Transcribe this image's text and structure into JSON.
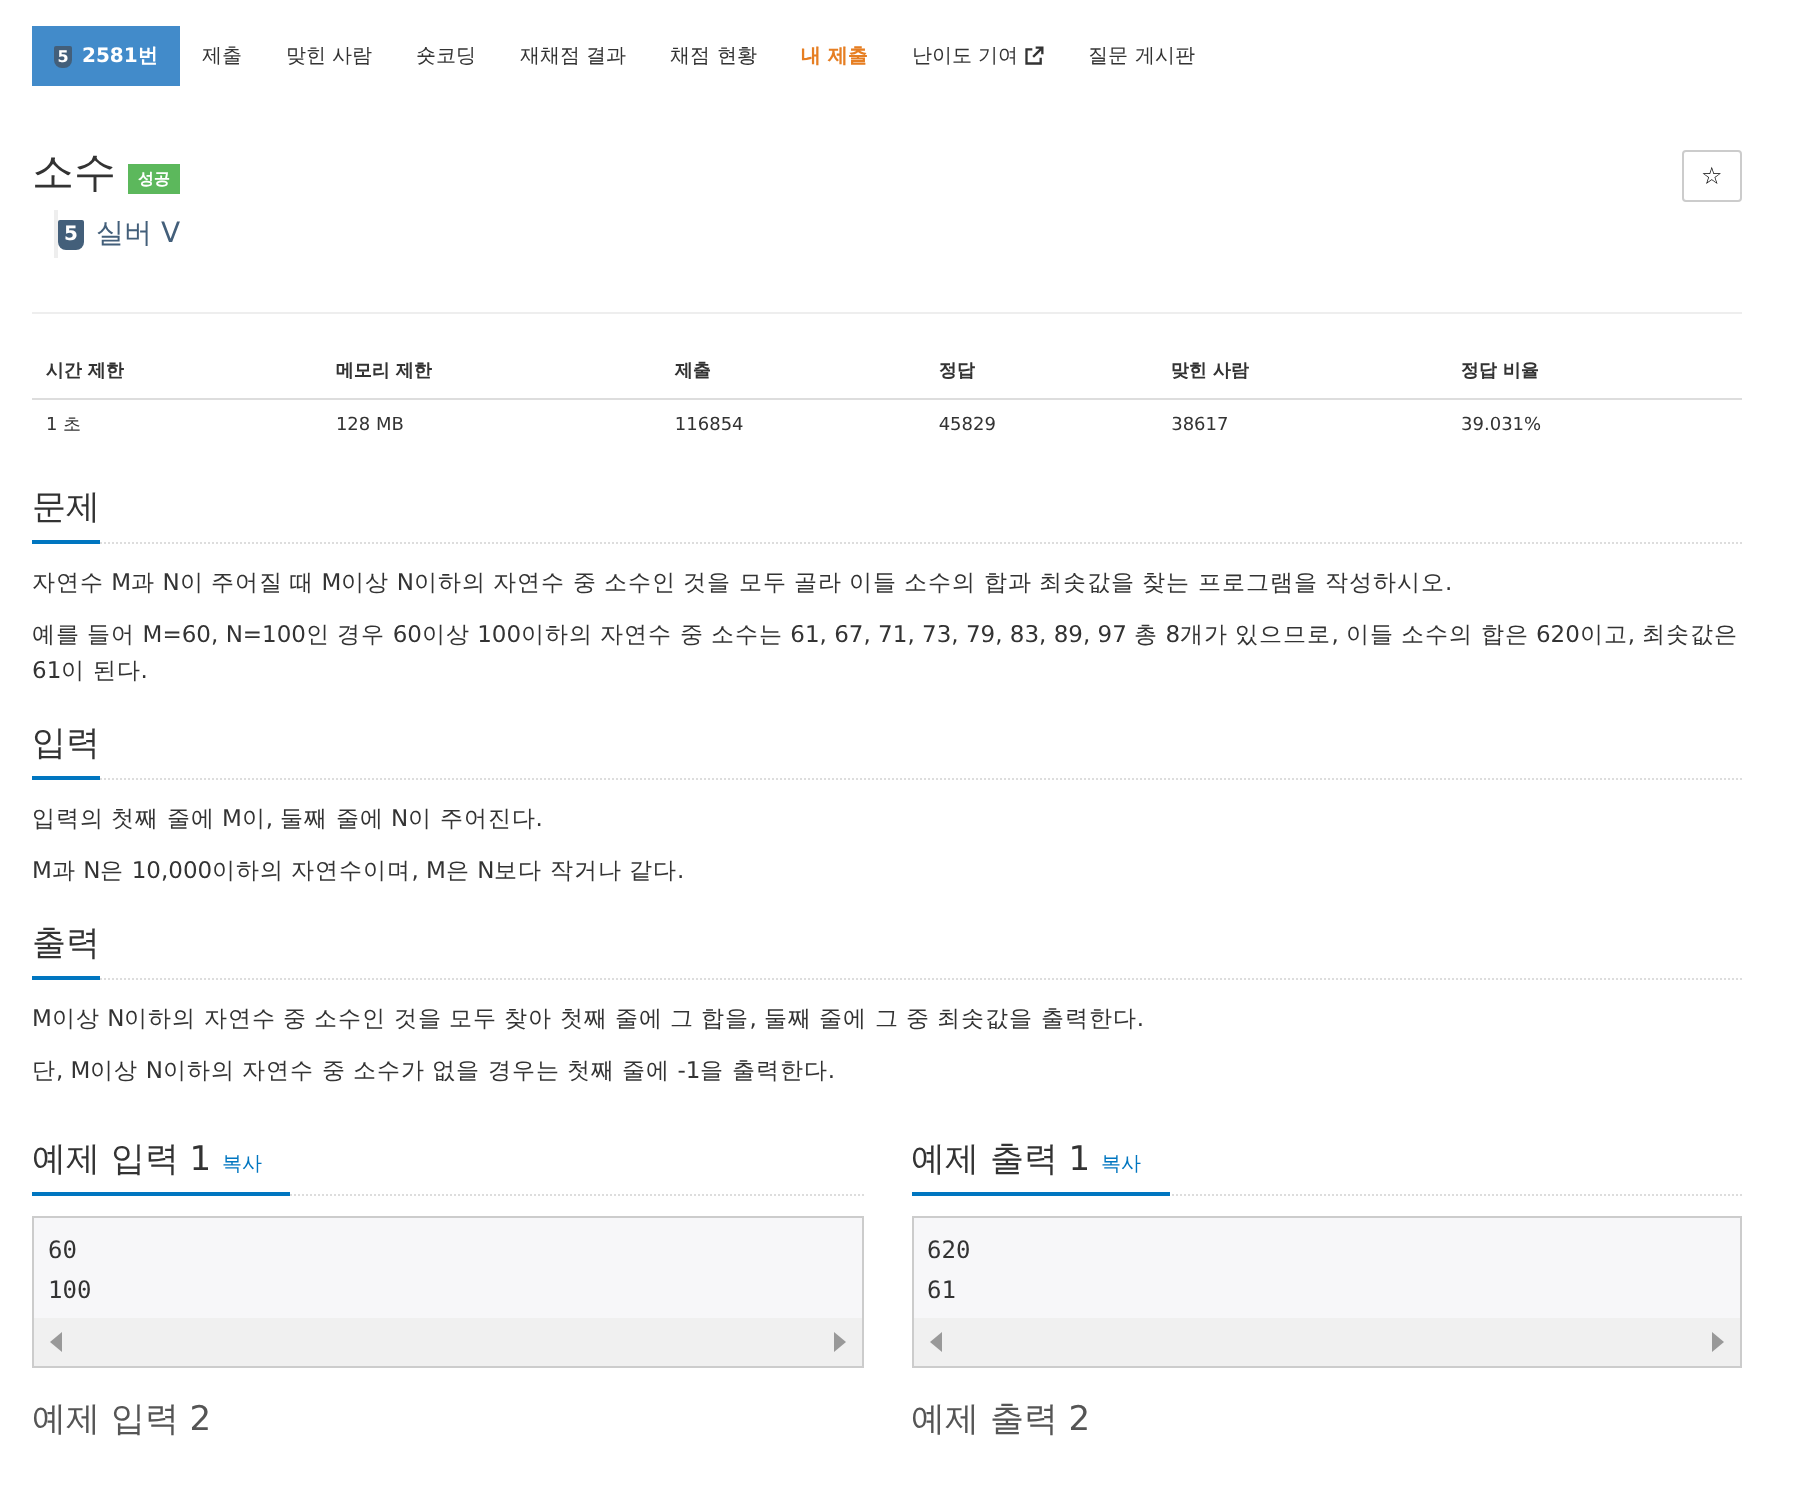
{
  "nav": [
    {
      "label": "2581번",
      "selected": true,
      "highlighted": false,
      "external": false,
      "badge": "5"
    },
    {
      "label": "제출",
      "selected": false,
      "highlighted": false,
      "external": false
    },
    {
      "label": "맞힌 사람",
      "selected": false,
      "highlighted": false,
      "external": false
    },
    {
      "label": "숏코딩",
      "selected": false,
      "highlighted": false,
      "external": false
    },
    {
      "label": "재채점 결과",
      "selected": false,
      "highlighted": false,
      "external": false
    },
    {
      "label": "채점 현황",
      "selected": false,
      "highlighted": false,
      "external": false
    },
    {
      "label": "내 제출",
      "selected": false,
      "highlighted": true,
      "external": false
    },
    {
      "label": "난이도 기여",
      "selected": false,
      "highlighted": false,
      "external": true
    },
    {
      "label": "질문 게시판",
      "selected": false,
      "highlighted": false,
      "external": false
    }
  ],
  "problem": {
    "title": "소수",
    "result_label": "성공",
    "star": "☆",
    "tier_badge": "5",
    "tier": "실버 V"
  },
  "stats": {
    "columns": [
      "시간 제한",
      "메모리 제한",
      "제출",
      "정답",
      "맞힌 사람",
      "정답 비율"
    ],
    "rows": [
      [
        "1 초",
        "128 MB",
        "116854",
        "45829",
        "38617",
        "39.031%"
      ]
    ]
  },
  "sections": [
    {
      "heading": "문제",
      "paragraphs": [
        "자연수 M과 N이 주어질 때 M이상 N이하의 자연수 중 소수인 것을 모두 골라 이들 소수의 합과 최솟값을 찾는 프로그램을 작성하시오.",
        "예를 들어 M=60, N=100인 경우 60이상 100이하의 자연수 중 소수는 61, 67, 71, 73, 79, 83, 89, 97 총 8개가 있으므로, 이들 소수의 합은 620이고, 최솟값은 61이 된다."
      ]
    },
    {
      "heading": "입력",
      "paragraphs": [
        "입력의 첫째 줄에 M이, 둘째 줄에 N이 주어진다.",
        "M과 N은 10,000이하의 자연수이며, M은 N보다 작거나 같다."
      ]
    },
    {
      "heading": "출력",
      "paragraphs": [
        "M이상 N이하의 자연수 중 소수인 것을 모두 찾아 첫째 줄에 그 합을, 둘째 줄에 그 중 최솟값을 출력한다.",
        "단, M이상 N이하의 자연수 중 소수가 없을 경우는 첫째 줄에 -1을 출력한다."
      ]
    }
  ],
  "samples": [
    {
      "heading": "예제 입력 1",
      "copy": "복사",
      "lines": [
        "60",
        "100"
      ]
    },
    {
      "heading": "예제 출력 1",
      "copy": "복사",
      "lines": [
        "620",
        "61"
      ]
    }
  ],
  "next_samples": [
    "예제 입력 2",
    "예제 출력 2"
  ]
}
